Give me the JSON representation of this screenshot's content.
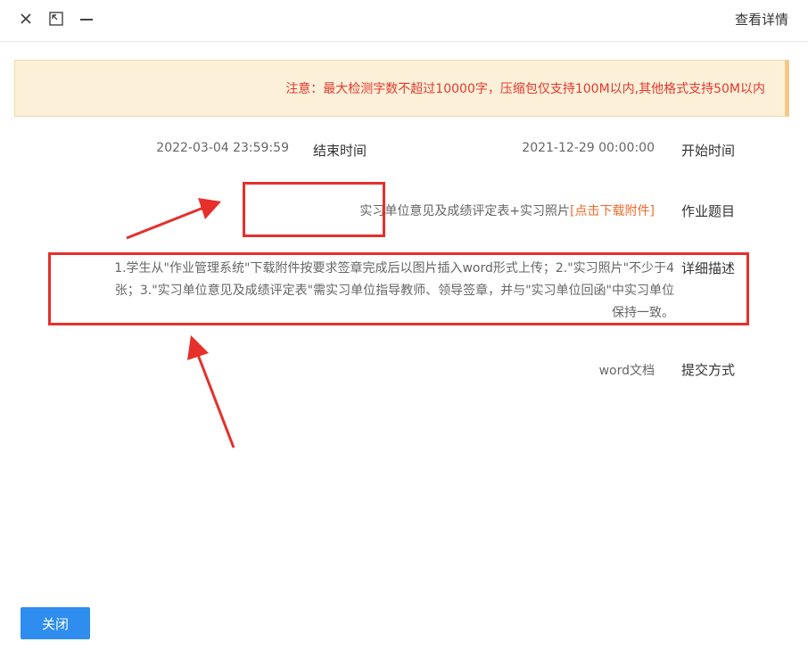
{
  "window": {
    "title": "查看详情",
    "controls": {
      "close_icon": "×",
      "restore_icon": "restore-icon",
      "minimize_icon": "—"
    }
  },
  "notice": {
    "text": "注意：最大检测字数不超过10000字，压缩包仅支持100M以内,其他格式支持50M以内"
  },
  "details": {
    "start_time_label": "开始时间",
    "start_time_value": "2021-12-29 00:00:00",
    "end_time_label": "结束时间",
    "end_time_value": "2022-03-04 23:59:59",
    "assignment_label": "作业题目",
    "assignment_value": "实习单位意见及成绩评定表+实习照片",
    "download_link": "[点击下载附件]",
    "description_label": "详细描述",
    "description_value": "1.学生从\"作业管理系统\"下载附件按要求签章完成后以图片插入word形式上传；2.\"实习照片\"不少于4张；3.\"实习单位意见及成绩评定表\"需实习单位指导教师、领导签章，并与\"实习单位回函\"中实习单位保持一致。",
    "submit_label": "提交方式",
    "submit_value": "word文档"
  },
  "footer": {
    "close_button": "关闭"
  },
  "colors": {
    "notice_bg": "#fcf0d9",
    "notice_text": "#e23a2e",
    "link": "#f06b2a",
    "highlight_box": "#e5302c",
    "primary_button": "#2e8def"
  }
}
